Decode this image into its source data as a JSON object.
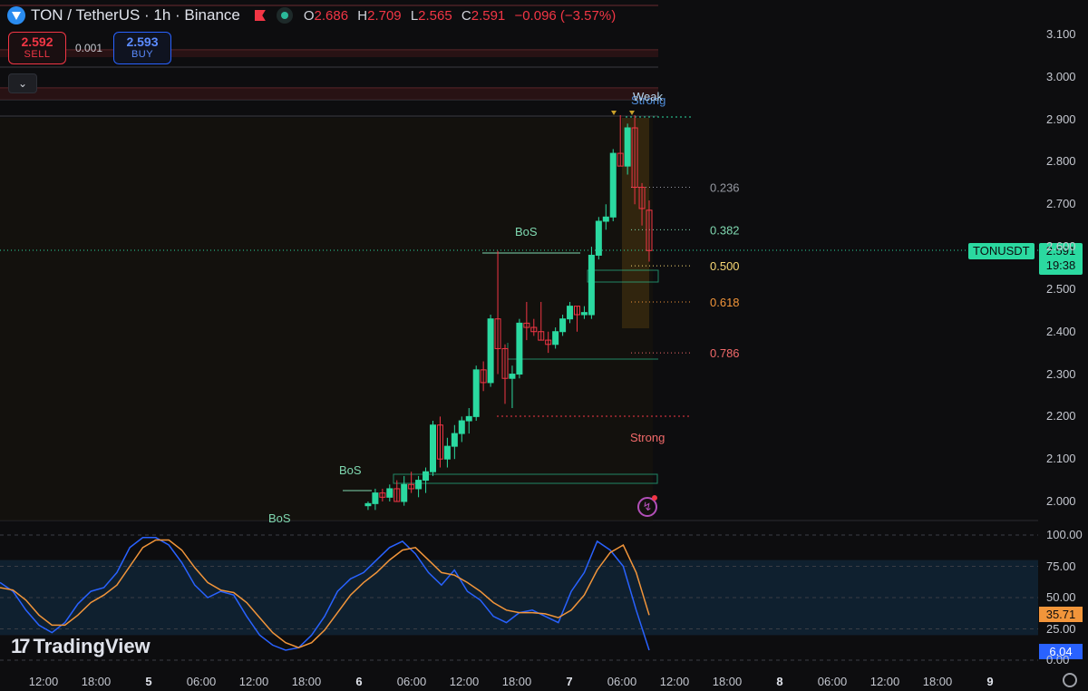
{
  "header": {
    "symbol_title": "TON / TetherUS · 1h · Binance",
    "ohlc": {
      "o_label": "O",
      "o": "2.686",
      "h_label": "H",
      "h": "2.709",
      "l_label": "L",
      "l": "2.565",
      "c_label": "C",
      "c": "2.591",
      "change": "−0.096 (−3.57%)"
    }
  },
  "trade": {
    "sell_price": "2.592",
    "sell_label": "SELL",
    "spread": "0.001",
    "buy_price": "2.593",
    "buy_label": "BUY"
  },
  "price_tag": {
    "symbol": "TONUSDT",
    "price": "2.591",
    "countdown": "19:38"
  },
  "osc_tags": {
    "k": "35.71",
    "d": "6.04"
  },
  "watermark": "TradingView",
  "colors": {
    "up": "#2bd9a0",
    "down": "#f23645",
    "k_line": "#f2953a",
    "d_line": "#2962ff",
    "accent": "#2bd9a0"
  },
  "chart_data": [
    {
      "type": "candlestick",
      "y_ticks": [
        "3.100",
        "3.000",
        "2.900",
        "2.800",
        "2.700",
        "2.600",
        "2.500",
        "2.400",
        "2.300",
        "2.200",
        "2.100",
        "2.000"
      ],
      "ylim": [
        1.96,
        3.13
      ],
      "x_ticks": [
        "12:00",
        "18:00",
        "5",
        "06:00",
        "12:00",
        "18:00",
        "6",
        "06:00",
        "12:00",
        "18:00",
        "7",
        "06:00",
        "12:00",
        "18:00",
        "8",
        "06:00",
        "12:00",
        "18:00",
        "9"
      ],
      "candles": [
        {
          "o": 1.99,
          "h": 2.0,
          "l": 1.98,
          "c": 1.995
        },
        {
          "o": 1.995,
          "h": 2.03,
          "l": 1.98,
          "c": 2.02
        },
        {
          "o": 2.02,
          "h": 2.03,
          "l": 2.0,
          "c": 2.01
        },
        {
          "o": 2.01,
          "h": 2.04,
          "l": 2.0,
          "c": 2.03
        },
        {
          "o": 2.03,
          "h": 2.05,
          "l": 2.0,
          "c": 2.0
        },
        {
          "o": 2.0,
          "h": 2.06,
          "l": 1.99,
          "c": 2.04
        },
        {
          "o": 2.04,
          "h": 2.07,
          "l": 2.02,
          "c": 2.03
        },
        {
          "o": 2.03,
          "h": 2.06,
          "l": 2.01,
          "c": 2.05
        },
        {
          "o": 2.05,
          "h": 2.08,
          "l": 2.02,
          "c": 2.07
        },
        {
          "o": 2.07,
          "h": 2.19,
          "l": 2.06,
          "c": 2.18
        },
        {
          "o": 2.18,
          "h": 2.2,
          "l": 2.08,
          "c": 2.1
        },
        {
          "o": 2.1,
          "h": 2.15,
          "l": 2.08,
          "c": 2.13
        },
        {
          "o": 2.13,
          "h": 2.18,
          "l": 2.1,
          "c": 2.16
        },
        {
          "o": 2.16,
          "h": 2.2,
          "l": 2.14,
          "c": 2.19
        },
        {
          "o": 2.19,
          "h": 2.22,
          "l": 2.16,
          "c": 2.2
        },
        {
          "o": 2.2,
          "h": 2.32,
          "l": 2.19,
          "c": 2.31
        },
        {
          "o": 2.31,
          "h": 2.33,
          "l": 2.26,
          "c": 2.28
        },
        {
          "o": 2.28,
          "h": 2.44,
          "l": 2.27,
          "c": 2.43
        },
        {
          "o": 2.43,
          "h": 2.59,
          "l": 2.3,
          "c": 2.36
        },
        {
          "o": 2.36,
          "h": 2.37,
          "l": 2.23,
          "c": 2.29
        },
        {
          "o": 2.29,
          "h": 2.32,
          "l": 2.22,
          "c": 2.3
        },
        {
          "o": 2.3,
          "h": 2.43,
          "l": 2.29,
          "c": 2.42
        },
        {
          "o": 2.42,
          "h": 2.47,
          "l": 2.38,
          "c": 2.41
        },
        {
          "o": 2.41,
          "h": 2.43,
          "l": 2.39,
          "c": 2.4
        },
        {
          "o": 2.4,
          "h": 2.47,
          "l": 2.38,
          "c": 2.38
        },
        {
          "o": 2.38,
          "h": 2.4,
          "l": 2.35,
          "c": 2.37
        },
        {
          "o": 2.37,
          "h": 2.41,
          "l": 2.36,
          "c": 2.4
        },
        {
          "o": 2.4,
          "h": 2.44,
          "l": 2.39,
          "c": 2.43
        },
        {
          "o": 2.43,
          "h": 2.47,
          "l": 2.42,
          "c": 2.46
        },
        {
          "o": 2.46,
          "h": 2.46,
          "l": 2.4,
          "c": 2.44
        },
        {
          "o": 2.44,
          "h": 2.46,
          "l": 2.43,
          "c": 2.445
        },
        {
          "o": 2.44,
          "h": 2.6,
          "l": 2.43,
          "c": 2.58
        },
        {
          "o": 2.58,
          "h": 2.67,
          "l": 2.57,
          "c": 2.66
        },
        {
          "o": 2.66,
          "h": 2.7,
          "l": 2.64,
          "c": 2.67
        },
        {
          "o": 2.67,
          "h": 2.83,
          "l": 2.66,
          "c": 2.82
        },
        {
          "o": 2.82,
          "h": 2.91,
          "l": 2.79,
          "c": 2.79
        },
        {
          "o": 2.79,
          "h": 2.89,
          "l": 2.77,
          "c": 2.88
        },
        {
          "o": 2.88,
          "h": 2.91,
          "l": 2.7,
          "c": 2.74
        },
        {
          "o": 2.74,
          "h": 2.75,
          "l": 2.65,
          "c": 2.69
        },
        {
          "o": 2.686,
          "h": 2.709,
          "l": 2.565,
          "c": 2.591
        }
      ],
      "fib_levels": [
        {
          "ratio": "0.236",
          "price": 2.74,
          "color": "#9598a1"
        },
        {
          "ratio": "0.382",
          "price": 2.64,
          "color": "#7fd8b0"
        },
        {
          "ratio": "0.500",
          "price": 2.555,
          "color": "#f7d774"
        },
        {
          "ratio": "0.618",
          "price": 2.47,
          "color": "#f2953a"
        },
        {
          "ratio": "0.786",
          "price": 2.35,
          "color": "#f26a6a"
        }
      ],
      "annotations": {
        "bos": "BoS",
        "weak": "Weak",
        "strong_top": "Strong",
        "strong_bottom": "Strong"
      }
    },
    {
      "type": "line",
      "name": "Stochastic RSI",
      "y_ticks": [
        "100.00",
        "75.00",
        "50.00",
        "25.00",
        "0.00"
      ],
      "ylim": [
        0,
        100
      ],
      "band": [
        20,
        80
      ],
      "series": [
        {
          "name": "K",
          "color": "#2962ff",
          "values": [
            62,
            55,
            40,
            28,
            22,
            30,
            45,
            55,
            58,
            70,
            90,
            98,
            98,
            92,
            78,
            60,
            50,
            55,
            52,
            35,
            20,
            12,
            8,
            10,
            20,
            35,
            55,
            65,
            70,
            80,
            90,
            95,
            85,
            70,
            60,
            72,
            55,
            48,
            35,
            30,
            38,
            40,
            35,
            30,
            55,
            70,
            95,
            88,
            75,
            40,
            8
          ]
        },
        {
          "name": "D",
          "color": "#f2953a",
          "values": [
            58,
            56,
            48,
            36,
            28,
            28,
            36,
            46,
            52,
            60,
            75,
            90,
            96,
            96,
            88,
            74,
            62,
            56,
            54,
            46,
            34,
            22,
            14,
            10,
            14,
            24,
            38,
            52,
            62,
            70,
            80,
            88,
            90,
            80,
            70,
            68,
            62,
            55,
            46,
            40,
            38,
            38,
            37,
            34,
            40,
            52,
            72,
            86,
            92,
            70,
            36
          ]
        }
      ]
    }
  ]
}
